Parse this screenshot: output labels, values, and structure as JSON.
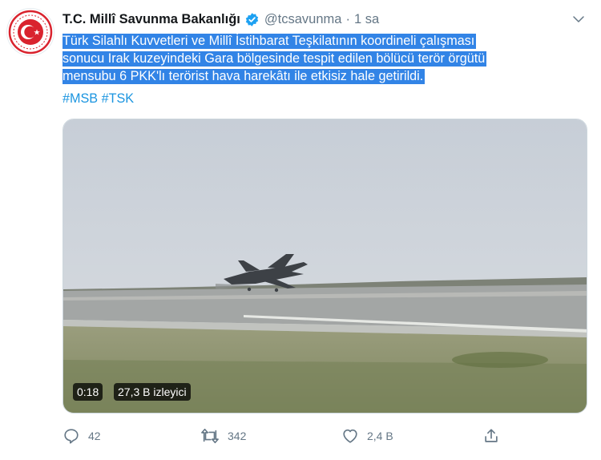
{
  "tweet": {
    "display_name": "T.C. Millî Savunma Bakanlığı",
    "handle": "@tcsavunma",
    "separator": "·",
    "time": "1 sa",
    "text_lines": [
      "Türk Silahlı Kuvvetleri ve Millî İstihbarat Teşkilatının koordineli çalışması",
      "sonucu Irak kuzeyindeki Gara bölgesinde tespit edilen bölücü terör örgütü",
      "mensubu 6 PKK'lı terörist hava harekâtı ile etkisiz hale getirildi."
    ],
    "hashtags": [
      "#MSB",
      "#TSK"
    ],
    "highlight_color": "#3284e6",
    "link_color": "#1b95e0"
  },
  "video": {
    "time": "0:18",
    "views": "27,3 B izleyici"
  },
  "actions": {
    "reply_count": "42",
    "retweet_count": "342",
    "like_count": "2,4 B"
  },
  "icons": {
    "avatar": "turkish-military-emblem-icon",
    "verified": "verified-badge-icon",
    "more": "chevron-down-icon",
    "reply": "reply-icon",
    "retweet": "retweet-icon",
    "like": "heart-icon",
    "share": "share-icon"
  }
}
